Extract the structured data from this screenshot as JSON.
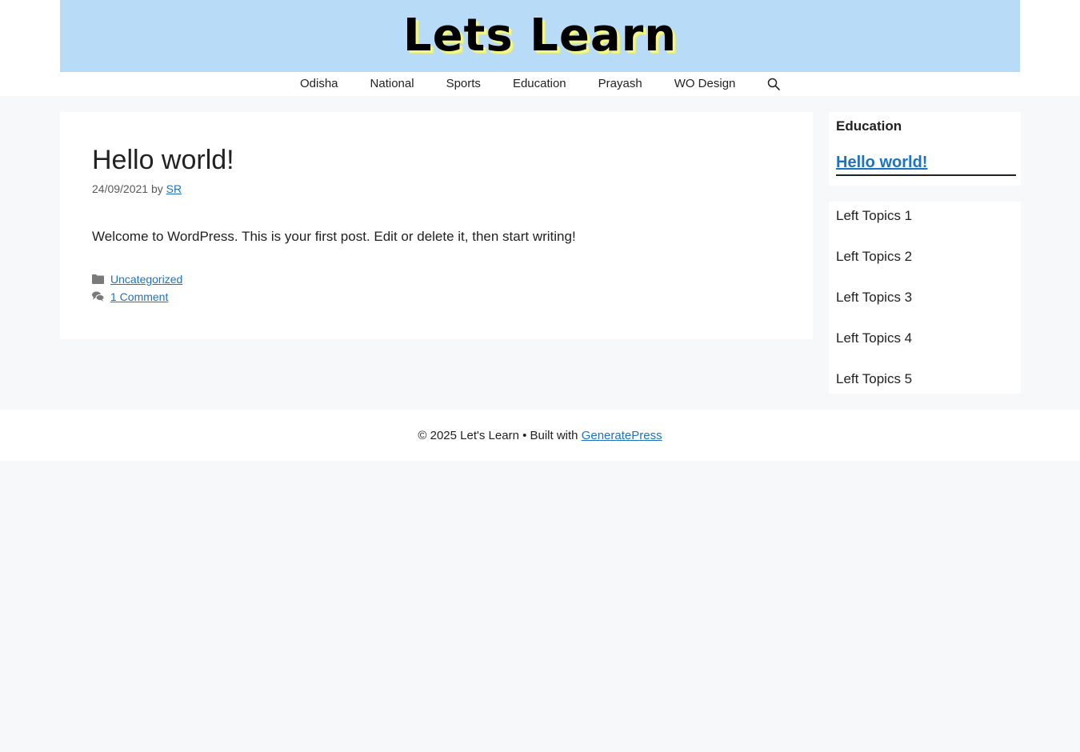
{
  "site": {
    "title": "Lets Learn"
  },
  "nav": {
    "items": [
      "Odisha",
      "National",
      "Sports",
      "Education",
      "Prayash",
      "WO Design"
    ],
    "search_icon": "search-icon"
  },
  "post": {
    "title": "Hello world!",
    "date": "24/09/2021",
    "by": "by",
    "author": "SR",
    "content": "Welcome to WordPress. This is your first post. Edit or delete it, then start writing!",
    "category": "Uncategorized",
    "comments": "1 Comment"
  },
  "sidebar": {
    "widget_title": "Education",
    "widget_link": "Hello world!",
    "topics": [
      "Left Topics 1",
      "Left Topics 2",
      "Left Topics 3",
      "Left Topics 4",
      "Left Topics 5"
    ]
  },
  "footer": {
    "text": "© 2025 Let's Learn • Built with",
    "link": "GeneratePress"
  },
  "colors": {
    "header_bg": "#b8dcf8",
    "link": "#1e73be",
    "page_bg": "#f7f8f9"
  }
}
